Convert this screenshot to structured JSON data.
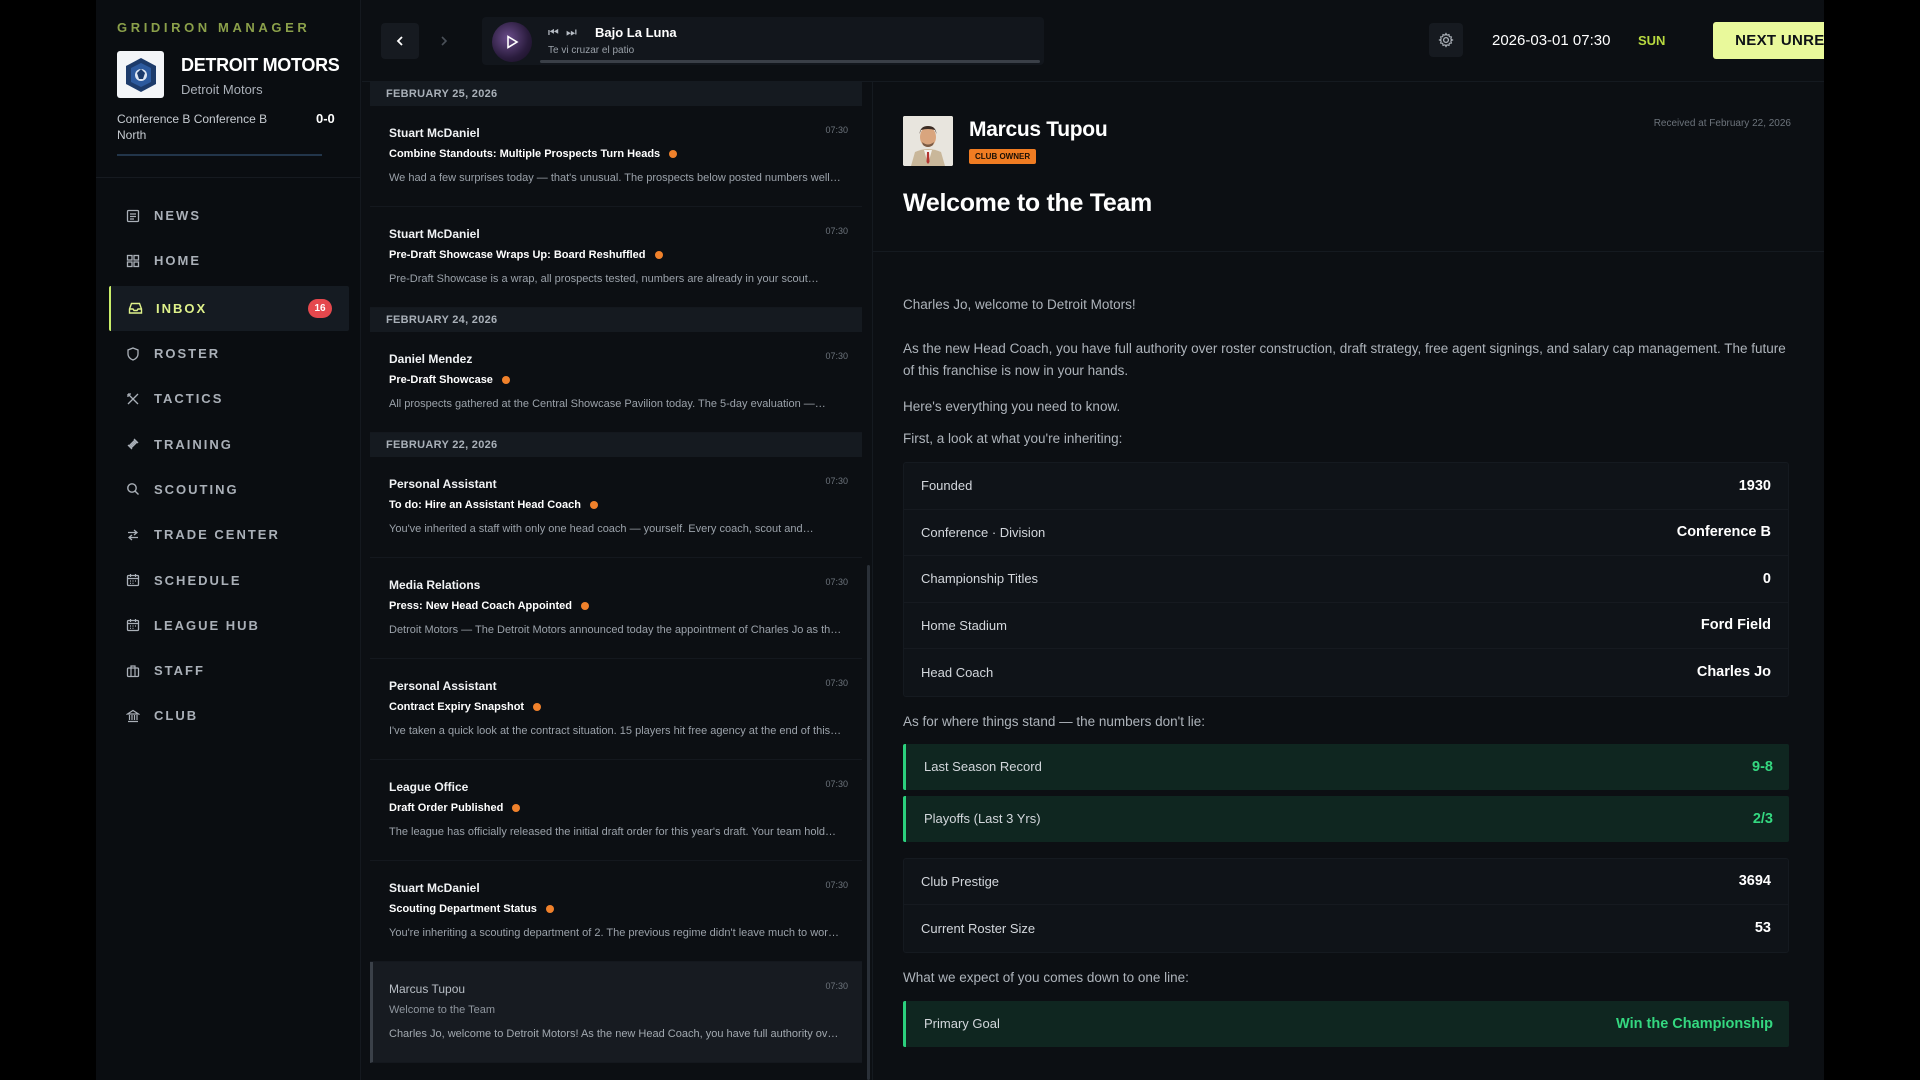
{
  "sidebar": {
    "brand": "GRIDIRON MANAGER",
    "team_name": "DETROIT MOTORS",
    "team_sub": "Detroit Motors",
    "conference": "Conference B Conference B North",
    "record": "0-0",
    "nav": [
      {
        "label": "NEWS",
        "icon": "news-icon"
      },
      {
        "label": "HOME",
        "icon": "home-icon"
      },
      {
        "label": "INBOX",
        "icon": "inbox-icon",
        "badge": "16",
        "active": true
      },
      {
        "label": "ROSTER",
        "icon": "shield-icon"
      },
      {
        "label": "TACTICS",
        "icon": "tactics-icon"
      },
      {
        "label": "TRAINING",
        "icon": "dumbbell-icon"
      },
      {
        "label": "SCOUTING",
        "icon": "search-icon"
      },
      {
        "label": "TRADE CENTER",
        "icon": "swap-icon"
      },
      {
        "label": "SCHEDULE",
        "icon": "calendar-icon"
      },
      {
        "label": "LEAGUE HUB",
        "icon": "calendar-icon"
      },
      {
        "label": "STAFF",
        "icon": "briefcase-icon"
      },
      {
        "label": "CLUB",
        "icon": "building-icon"
      }
    ]
  },
  "topbar": {
    "song": "Bajo La Luna",
    "artist": "Te vi cruzar el patio",
    "datetime": "2026-03-01 07:30",
    "day": "SUN",
    "next_unread": "NEXT UNREAD"
  },
  "mail_groups": [
    {
      "date": "FEBRUARY 25, 2026",
      "mails": [
        {
          "from": "Stuart McDaniel",
          "time": "07:30",
          "subject": "Combine Standouts: Multiple Prospects Turn Heads",
          "preview": "We had a few surprises today — that's unusual. The prospects below posted numbers well…",
          "unread": true
        },
        {
          "from": "Stuart McDaniel",
          "time": "07:30",
          "subject": "Pre-Draft Showcase Wraps Up: Board Reshuffled",
          "preview": "Pre-Draft Showcase is a wrap, all prospects tested, numbers are already in your scout…",
          "unread": true
        }
      ]
    },
    {
      "date": "FEBRUARY 24, 2026",
      "mails": [
        {
          "from": "Daniel Mendez",
          "time": "07:30",
          "subject": "Pre-Draft Showcase",
          "preview": "All prospects gathered at the Central Showcase Pavilion today. The 5-day evaluation —…",
          "unread": true
        }
      ]
    },
    {
      "date": "FEBRUARY 22, 2026",
      "mails": [
        {
          "from": "Personal Assistant",
          "time": "07:30",
          "subject": "To do: Hire an Assistant Head Coach",
          "preview": "You've inherited a staff with only one head coach — yourself. Every coach, scout and…",
          "unread": true
        },
        {
          "from": "Media Relations",
          "time": "07:30",
          "subject": "Press: New Head Coach Appointed",
          "preview": "Detroit Motors — The Detroit Motors announced today the appointment of Charles Jo as th…",
          "unread": true
        },
        {
          "from": "Personal Assistant",
          "time": "07:30",
          "subject": "Contract Expiry Snapshot",
          "preview": "I've taken a quick look at the contract situation. 15 players hit free agency at the end of this…",
          "unread": true
        },
        {
          "from": "League Office",
          "time": "07:30",
          "subject": "Draft Order Published",
          "preview": "The league has officially released the initial draft order for this year's draft. Your team hold…",
          "unread": true
        },
        {
          "from": "Stuart McDaniel",
          "time": "07:30",
          "subject": "Scouting Department Status",
          "preview": "You're inheriting a scouting department of 2. The previous regime didn't leave much to wor…",
          "unread": true
        },
        {
          "from": "Marcus Tupou",
          "time": "07:30",
          "subject": "Welcome to the Team",
          "preview": "Charles Jo, welcome to Detroit Motors! As the new Head Coach, you have full authority ov…",
          "unread": false
        }
      ]
    }
  ],
  "reader": {
    "sender": "Marcus Tupou",
    "role": "CLUB OWNER",
    "received": "Received at February 22, 2026",
    "title": "Welcome to the Team",
    "p1": "Charles Jo, welcome to Detroit Motors!",
    "p2": "As the new Head Coach, you have full authority over roster construction, draft strategy, free agent signings, and salary cap management. The future of this franchise is now in your hands.",
    "p3": "Here's everything you need to know.",
    "p4": "First, a look at what you're inheriting:",
    "facts": [
      {
        "k": "Founded",
        "v": "1930"
      },
      {
        "k": "Conference · Division",
        "v": "Conference B"
      },
      {
        "k": "Championship Titles",
        "v": "0"
      },
      {
        "k": "Home Stadium",
        "v": "Ford Field"
      },
      {
        "k": "Head Coach",
        "v": "Charles Jo"
      }
    ],
    "p5": "As for where things stand — the numbers don't lie:",
    "highlights": [
      {
        "k": "Last Season Record",
        "v": "9-8"
      },
      {
        "k": "Playoffs (Last 3 Yrs)",
        "v": "2/3"
      }
    ],
    "stats": [
      {
        "k": "Club Prestige",
        "v": "3694"
      },
      {
        "k": "Current Roster Size",
        "v": "53"
      }
    ],
    "p6": "What we expect of you comes down to one line:",
    "goal": {
      "k": "Primary Goal",
      "v": "Win the Championship"
    }
  }
}
